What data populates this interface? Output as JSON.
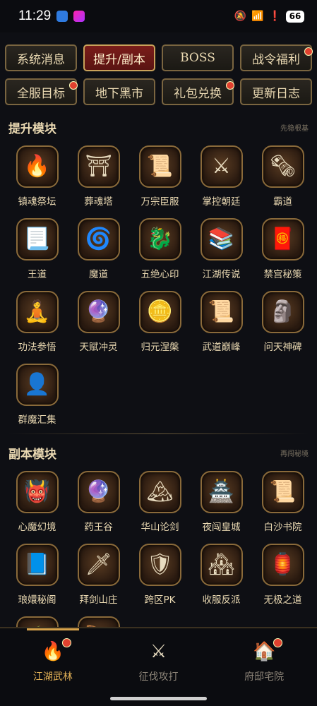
{
  "status_bar": {
    "time": "11:29",
    "battery": "66"
  },
  "tabs": [
    {
      "label": "系统消息",
      "active": false,
      "badge": false
    },
    {
      "label": "提升/副本",
      "active": true,
      "badge": false
    },
    {
      "label": "BOSS",
      "active": false,
      "badge": false
    },
    {
      "label": "战令福利",
      "active": false,
      "badge": true
    },
    {
      "label": "全服目标",
      "active": false,
      "badge": true
    },
    {
      "label": "地下黑市",
      "active": false,
      "badge": false
    },
    {
      "label": "礼包兑换",
      "active": false,
      "badge": true
    },
    {
      "label": "更新日志",
      "active": false,
      "badge": false
    }
  ],
  "section1": {
    "title": "提升模块",
    "hint": "先稳根基",
    "items": [
      {
        "label": "镇魂祭坛",
        "icon": "🔥"
      },
      {
        "label": "葬魂塔",
        "icon": "⛩"
      },
      {
        "label": "万宗臣服",
        "icon": "📜"
      },
      {
        "label": "掌控朝廷",
        "icon": "⚔"
      },
      {
        "label": "霸道",
        "icon": "🗞"
      },
      {
        "label": "王道",
        "icon": "📃"
      },
      {
        "label": "魔道",
        "icon": "🌀"
      },
      {
        "label": "五绝心印",
        "icon": "🐉"
      },
      {
        "label": "江湖传说",
        "icon": "📚"
      },
      {
        "label": "禁宫秘策",
        "icon": "🧧"
      },
      {
        "label": "功法参悟",
        "icon": "🧘"
      },
      {
        "label": "天赋冲灵",
        "icon": "🔮"
      },
      {
        "label": "归元涅槃",
        "icon": "🪙"
      },
      {
        "label": "武道巅峰",
        "icon": "📜"
      },
      {
        "label": "问天神碑",
        "icon": "🗿"
      },
      {
        "label": "群魔汇集",
        "icon": "👤"
      }
    ]
  },
  "section2": {
    "title": "副本模块",
    "hint": "再闯秘境",
    "items": [
      {
        "label": "心魔幻境",
        "icon": "👹"
      },
      {
        "label": "药王谷",
        "icon": "🔮"
      },
      {
        "label": "华山论剑",
        "icon": "🏔"
      },
      {
        "label": "夜闯皇城",
        "icon": "🏯"
      },
      {
        "label": "白沙书院",
        "icon": "📜"
      },
      {
        "label": "琅嬛秘阁",
        "icon": "📘"
      },
      {
        "label": "拜剑山庄",
        "icon": "🗡"
      },
      {
        "label": "跨区PK",
        "icon": "🛡"
      },
      {
        "label": "收服反派",
        "icon": "🏘"
      },
      {
        "label": "无极之道",
        "icon": "🏮"
      },
      {
        "label": "",
        "icon": "🌾"
      },
      {
        "label": "",
        "icon": "🪶"
      }
    ]
  },
  "bottom_nav": [
    {
      "label": "江湖武林",
      "icon": "🔥",
      "active": true,
      "badge": true
    },
    {
      "label": "征伐攻打",
      "icon": "⚔",
      "active": false,
      "badge": false
    },
    {
      "label": "府邸宅院",
      "icon": "🏠",
      "active": false,
      "badge": true
    }
  ],
  "colors": {
    "accent": "#e5b357",
    "active_tab": "#7a1d1a",
    "badge": "#e0412f"
  }
}
